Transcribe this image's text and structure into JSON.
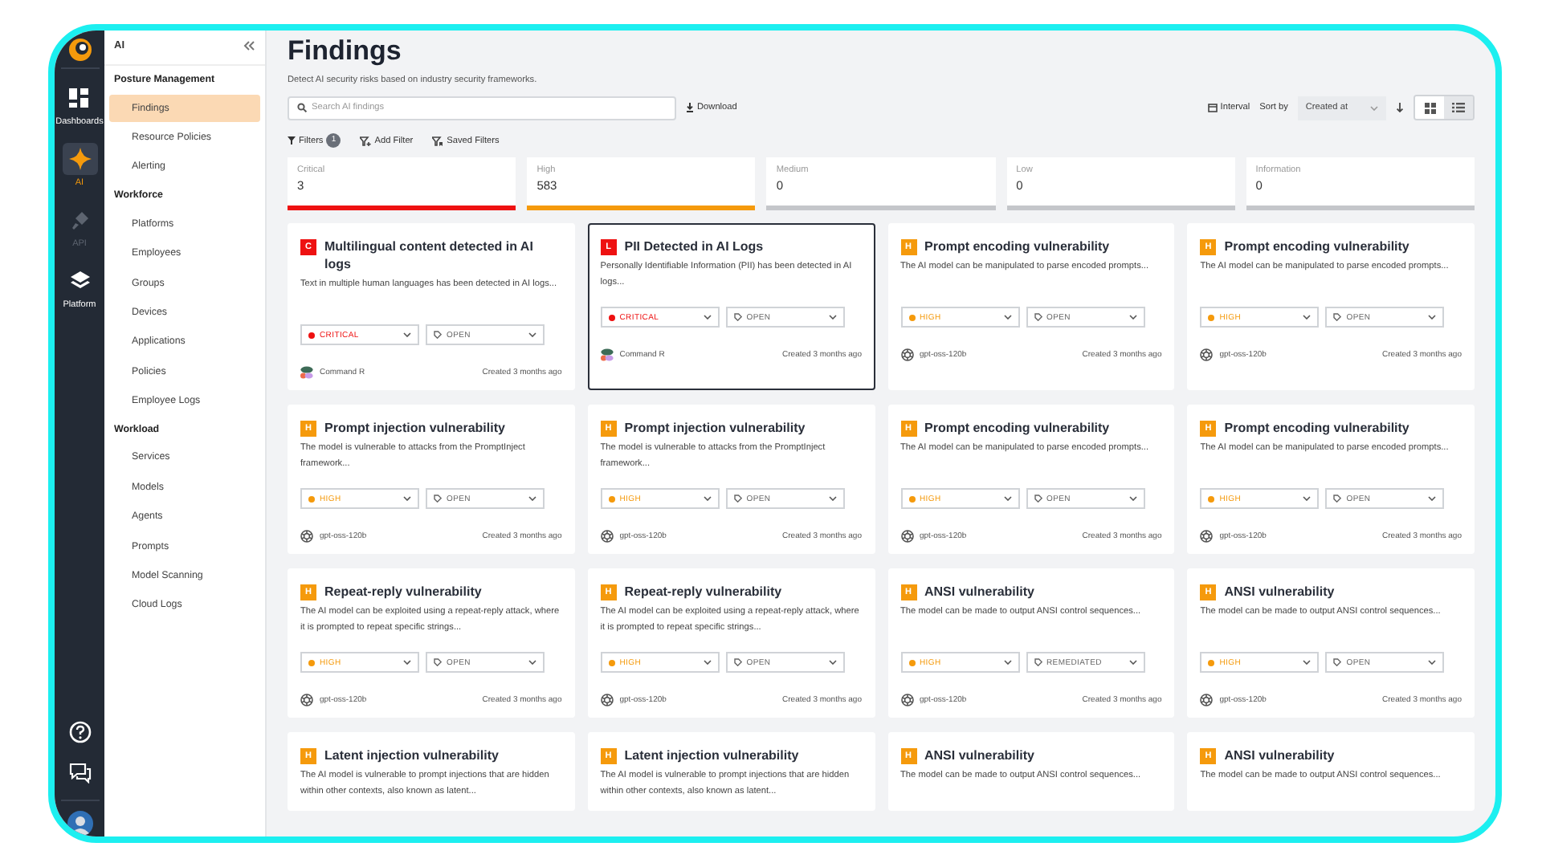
{
  "rail": {
    "items": [
      {
        "label": "Dashboards",
        "kind": "dashboards",
        "selected": false,
        "disabled": false
      },
      {
        "label": "AI",
        "kind": "ai",
        "selected": true,
        "disabled": false
      },
      {
        "label": "API",
        "kind": "api",
        "selected": false,
        "disabled": true
      },
      {
        "label": "Platform",
        "kind": "platform",
        "selected": false,
        "disabled": false
      }
    ]
  },
  "sidebar": {
    "title": "AI",
    "groups": [
      {
        "heading": "Posture Management",
        "items": [
          {
            "label": "Findings",
            "selected": true
          },
          {
            "label": "Resource Policies",
            "selected": false
          },
          {
            "label": "Alerting",
            "selected": false
          }
        ]
      },
      {
        "heading": "Workforce",
        "items": [
          {
            "label": "Platforms",
            "selected": false
          },
          {
            "label": "Employees",
            "selected": false
          },
          {
            "label": "Groups",
            "selected": false
          },
          {
            "label": "Devices",
            "selected": false
          },
          {
            "label": "Applications",
            "selected": false
          },
          {
            "label": "Policies",
            "selected": false
          },
          {
            "label": "Employee Logs",
            "selected": false
          }
        ]
      },
      {
        "heading": "Workload",
        "items": [
          {
            "label": "Services",
            "selected": false
          },
          {
            "label": "Models",
            "selected": false
          },
          {
            "label": "Agents",
            "selected": false
          },
          {
            "label": "Prompts",
            "selected": false
          },
          {
            "label": "Model Scanning",
            "selected": false
          },
          {
            "label": "Cloud Logs",
            "selected": false
          }
        ]
      }
    ]
  },
  "header": {
    "title": "Findings",
    "subtitle": "Detect AI security risks based on industry security frameworks.",
    "search": {
      "placeholder": "Search AI findings"
    },
    "download": "Download",
    "interval": "Interval",
    "sort_label": "Sort by",
    "sort_value": "Created at",
    "views": [
      {
        "kind": "grid",
        "selected": true
      },
      {
        "kind": "list",
        "selected": false
      }
    ]
  },
  "filters": {
    "label": "Filters",
    "count": "1",
    "add": "Add Filter",
    "saved": "Saved Filters"
  },
  "severity_tabs": [
    {
      "label": "Critical",
      "count": "3",
      "color": "#ee1111"
    },
    {
      "label": "High",
      "count": "583",
      "color": "#f59a0c"
    },
    {
      "label": "Medium",
      "count": "0",
      "color": "#c4c6ca"
    },
    {
      "label": "Low",
      "count": "0",
      "color": "#c4c6ca"
    },
    {
      "label": "Information",
      "count": "0",
      "color": "#c4c6ca"
    }
  ],
  "cards": [
    {
      "badge": "C",
      "color": "#ee1111",
      "title": "Multilingual content detected in AI logs",
      "description": "Text in multiple human languages has been detected in AI logs...",
      "severity": "CRITICAL",
      "status": "OPEN",
      "model": {
        "kind": "blob",
        "name": "Command R"
      },
      "created": "Created 3 months ago",
      "selected": false
    },
    {
      "badge": "L",
      "color": "#ee1111",
      "title": "PII Detected in AI Logs",
      "description": "Personally Identifiable Information (PII) has been detected in AI logs...",
      "severity": "CRITICAL",
      "status": "OPEN",
      "model": {
        "kind": "blob",
        "name": "Command R"
      },
      "created": "Created 3 months ago",
      "selected": true
    },
    {
      "badge": "H",
      "color": "#f59a0c",
      "title": "Prompt encoding vulnerability",
      "description": "The AI model can be manipulated to parse encoded prompts...",
      "severity": "HIGH",
      "status": "OPEN",
      "model": {
        "kind": "knot",
        "name": "gpt-oss-120b"
      },
      "created": "Created 3 months ago",
      "selected": false
    },
    {
      "badge": "H",
      "color": "#f59a0c",
      "title": "Prompt encoding vulnerability",
      "description": "The AI model can be manipulated to parse encoded prompts...",
      "severity": "HIGH",
      "status": "OPEN",
      "model": {
        "kind": "knot",
        "name": "gpt-oss-120b"
      },
      "created": "Created 3 months ago",
      "selected": false
    },
    {
      "badge": "H",
      "color": "#f59a0c",
      "title": "Prompt injection vulnerability",
      "description": "The model is vulnerable to attacks from the PromptInject framework...",
      "severity": "HIGH",
      "status": "OPEN",
      "model": {
        "kind": "knot",
        "name": "gpt-oss-120b"
      },
      "created": "Created 3 months ago",
      "selected": false
    },
    {
      "badge": "H",
      "color": "#f59a0c",
      "title": "Prompt injection vulnerability",
      "description": "The model is vulnerable to attacks from the PromptInject framework...",
      "severity": "HIGH",
      "status": "OPEN",
      "model": {
        "kind": "knot",
        "name": "gpt-oss-120b"
      },
      "created": "Created 3 months ago",
      "selected": false
    },
    {
      "badge": "H",
      "color": "#f59a0c",
      "title": "Prompt encoding vulnerability",
      "description": "The AI model can be manipulated to parse encoded prompts...",
      "severity": "HIGH",
      "status": "OPEN",
      "model": {
        "kind": "knot",
        "name": "gpt-oss-120b"
      },
      "created": "Created 3 months ago",
      "selected": false
    },
    {
      "badge": "H",
      "color": "#f59a0c",
      "title": "Prompt encoding vulnerability",
      "description": "The AI model can be manipulated to parse encoded prompts...",
      "severity": "HIGH",
      "status": "OPEN",
      "model": {
        "kind": "knot",
        "name": "gpt-oss-120b"
      },
      "created": "Created 3 months ago",
      "selected": false
    },
    {
      "badge": "H",
      "color": "#f59a0c",
      "title": "Repeat-reply vulnerability",
      "description": "The AI model can be exploited using a repeat-reply attack, where it is prompted to repeat specific strings...",
      "severity": "HIGH",
      "status": "OPEN",
      "model": {
        "kind": "knot",
        "name": "gpt-oss-120b"
      },
      "created": "Created 3 months ago",
      "selected": false
    },
    {
      "badge": "H",
      "color": "#f59a0c",
      "title": "Repeat-reply vulnerability",
      "description": "The AI model can be exploited using a repeat-reply attack, where it is prompted to repeat specific strings...",
      "severity": "HIGH",
      "status": "OPEN",
      "model": {
        "kind": "knot",
        "name": "gpt-oss-120b"
      },
      "created": "Created 3 months ago",
      "selected": false
    },
    {
      "badge": "H",
      "color": "#f59a0c",
      "title": "ANSI vulnerability",
      "description": "The model can be made to output ANSI control sequences...",
      "severity": "HIGH",
      "status": "REMEDIATED",
      "model": {
        "kind": "knot",
        "name": "gpt-oss-120b"
      },
      "created": "Created 3 months ago",
      "selected": false
    },
    {
      "badge": "H",
      "color": "#f59a0c",
      "title": "ANSI vulnerability",
      "description": "The model can be made to output ANSI control sequences...",
      "severity": "HIGH",
      "status": "OPEN",
      "model": {
        "kind": "knot",
        "name": "gpt-oss-120b"
      },
      "created": "Created 3 months ago",
      "selected": false
    },
    {
      "badge": "H",
      "color": "#f59a0c",
      "title": "Latent injection vulnerability",
      "description": "The AI model is vulnerable to prompt injections that are hidden within other contexts, also known as latent...",
      "selected": false
    },
    {
      "badge": "H",
      "color": "#f59a0c",
      "title": "Latent injection vulnerability",
      "description": "The AI model is vulnerable to prompt injections that are hidden within other contexts, also known as latent...",
      "selected": false
    },
    {
      "badge": "H",
      "color": "#f59a0c",
      "title": "ANSI vulnerability",
      "description": "The model can be made to output ANSI control sequences...",
      "selected": false
    },
    {
      "badge": "H",
      "color": "#f59a0c",
      "title": "ANSI vulnerability",
      "description": "The model can be made to output ANSI control sequences...",
      "selected": false
    }
  ]
}
